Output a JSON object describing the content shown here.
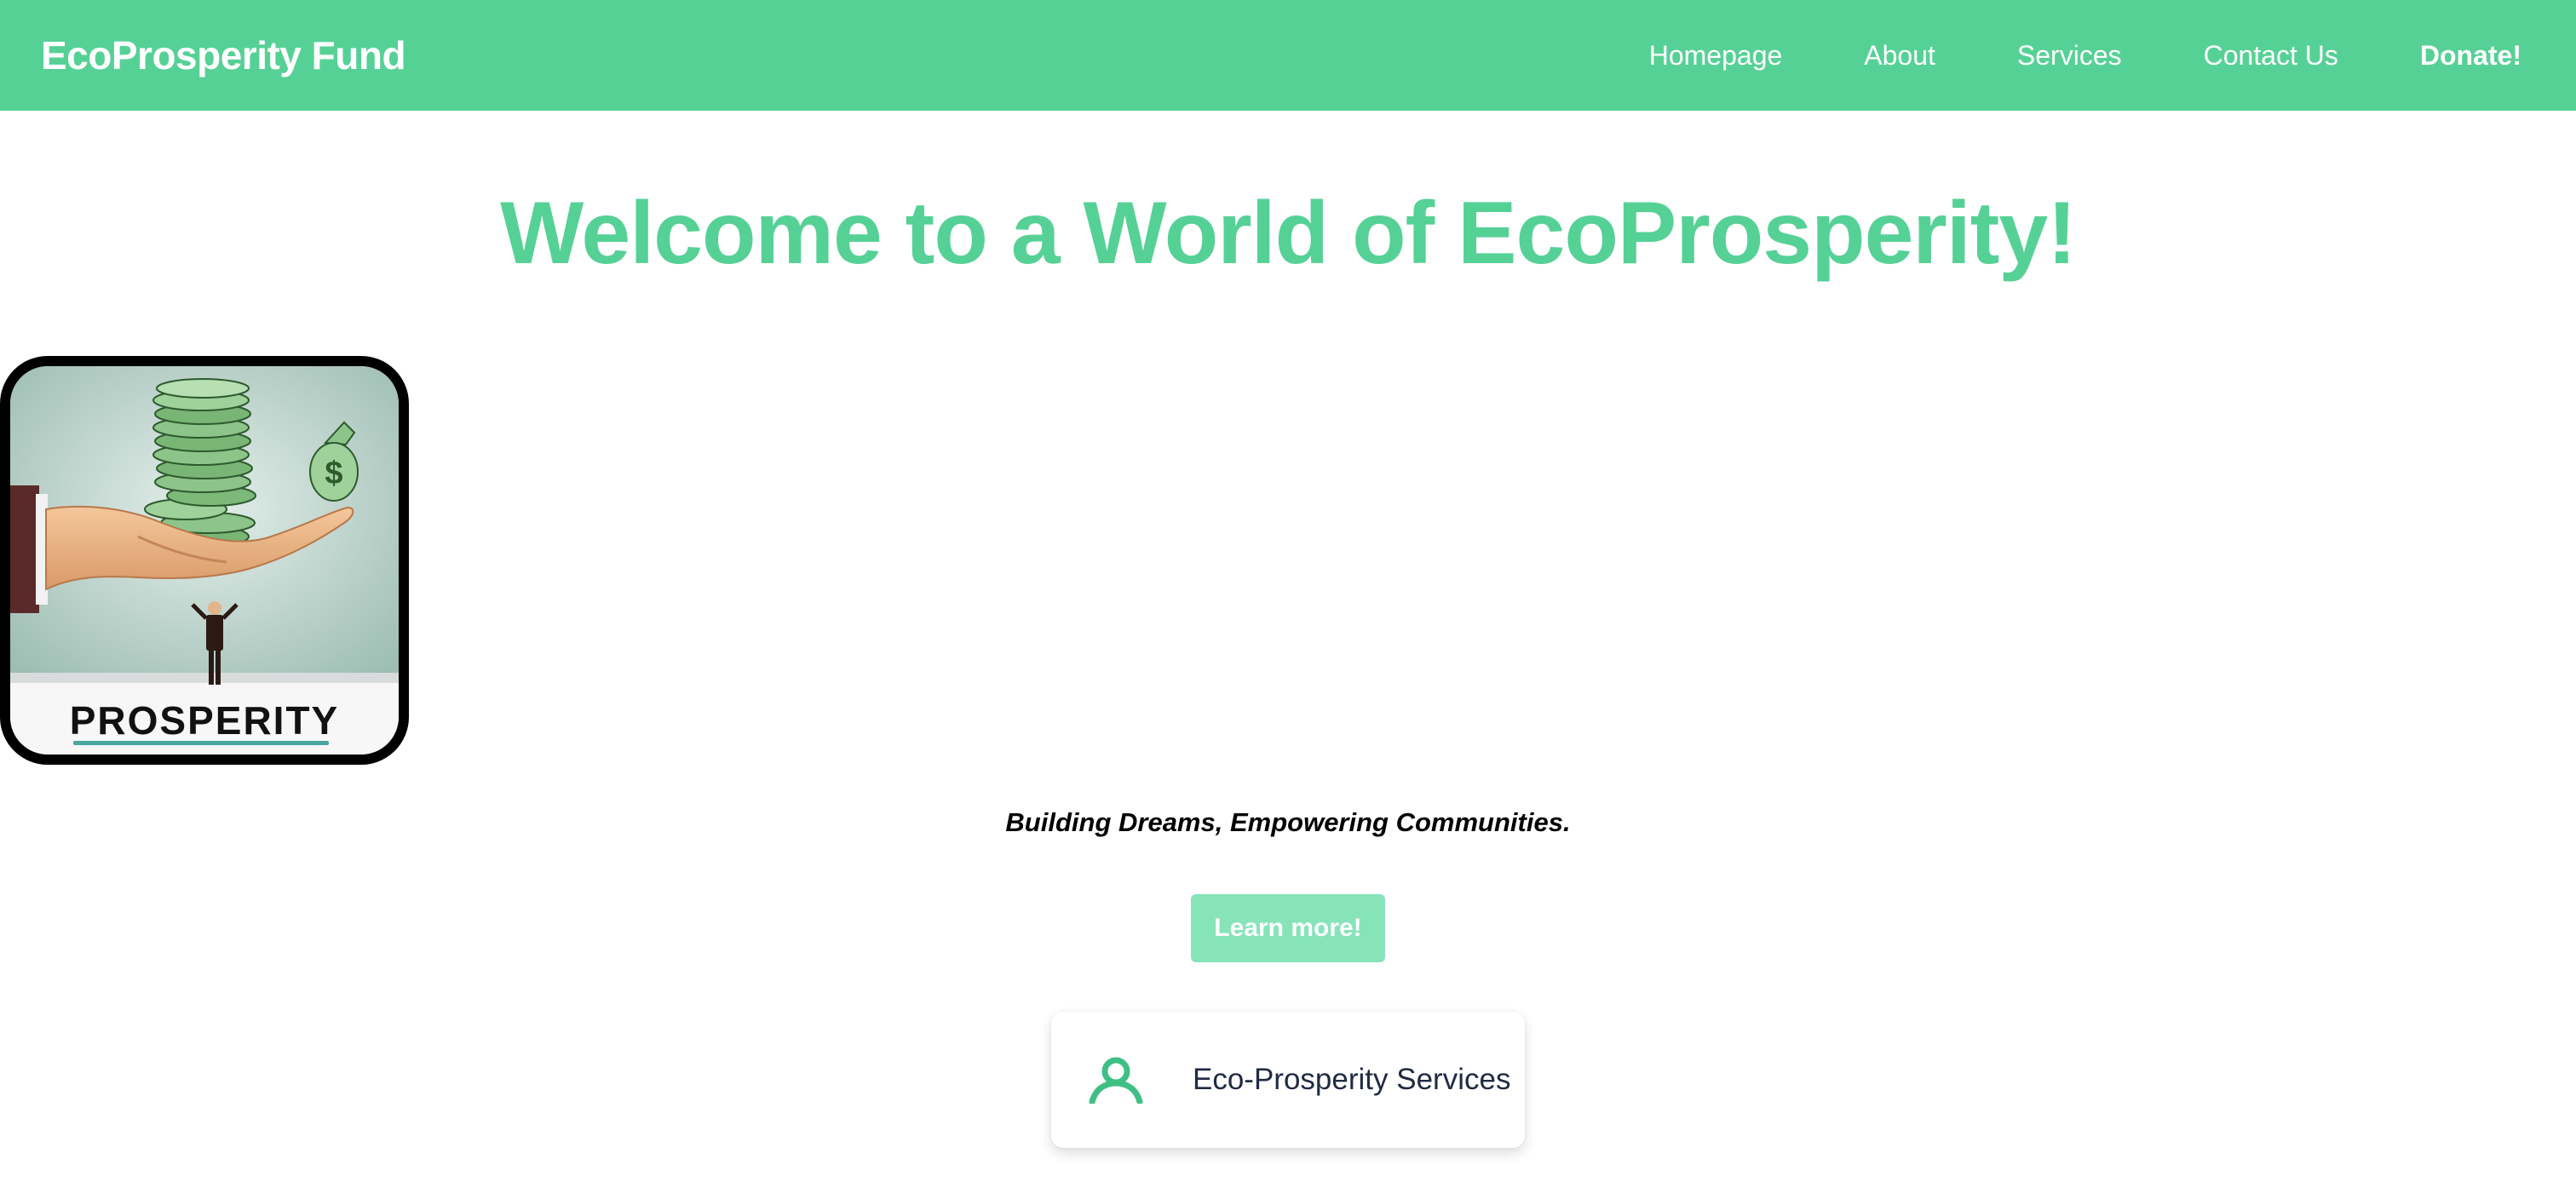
{
  "header": {
    "brand": "EcoProsperity Fund",
    "nav": [
      {
        "label": "Homepage"
      },
      {
        "label": "About"
      },
      {
        "label": "Services"
      },
      {
        "label": "Contact Us"
      },
      {
        "label": "Donate!"
      }
    ]
  },
  "hero": {
    "title": "Welcome to a World of EcoProsperity!",
    "image": {
      "caption": "PROSPERITY",
      "bag_symbol": "$"
    },
    "tagline": "Building Dreams, Empowering Communities.",
    "cta_label": "Learn more!"
  },
  "services": {
    "card_title": "Eco-Prosperity Services",
    "card_icon": "user-icon"
  },
  "colors": {
    "brand_green": "#56d196",
    "cta_green": "#86e4b8",
    "card_text": "#1f2a44"
  }
}
